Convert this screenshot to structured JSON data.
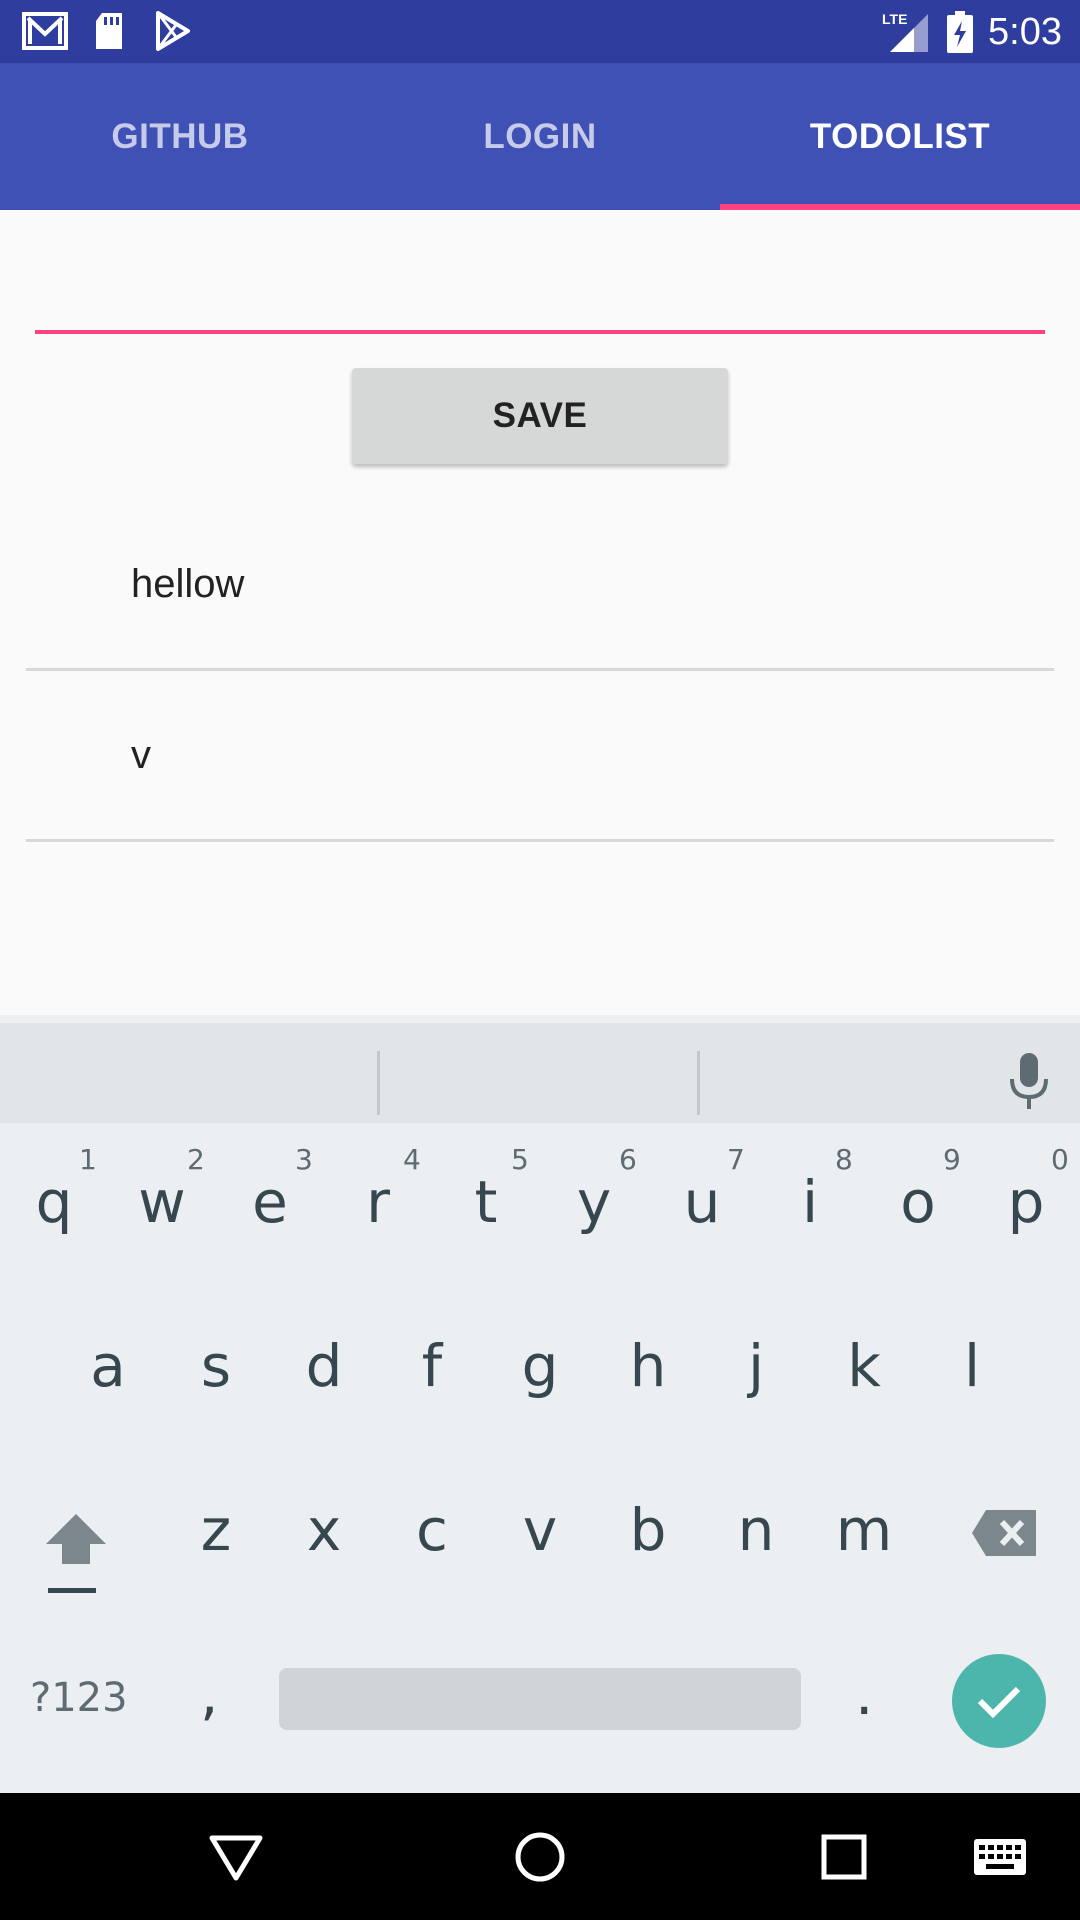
{
  "status_bar": {
    "time": "5:03",
    "network": "LTE",
    "left_icons": [
      "gmail-icon",
      "sd-card-icon",
      "play-store-icon"
    ],
    "right_icons": [
      "lte-signal-icon",
      "battery-charging-icon"
    ]
  },
  "tabs": [
    {
      "label": "GITHUB",
      "active": false
    },
    {
      "label": "LOGIN",
      "active": false
    },
    {
      "label": "TODOLIST",
      "active": true
    }
  ],
  "todo": {
    "input_value": "",
    "input_placeholder": "",
    "save_label": "SAVE",
    "items": [
      "hellow",
      "v"
    ]
  },
  "keyboard": {
    "row1": [
      "q",
      "w",
      "e",
      "r",
      "t",
      "y",
      "u",
      "i",
      "o",
      "p"
    ],
    "row1_numbers": [
      "1",
      "2",
      "3",
      "4",
      "5",
      "6",
      "7",
      "8",
      "9",
      "0"
    ],
    "row2": [
      "a",
      "s",
      "d",
      "f",
      "g",
      "h",
      "j",
      "k",
      "l"
    ],
    "row3": [
      "z",
      "x",
      "c",
      "v",
      "b",
      "n",
      "m"
    ],
    "symbols_label": "?123",
    "comma": ",",
    "period": "."
  },
  "colors": {
    "status_bar": "#2f3d9e",
    "app_bar": "#3f51b5",
    "accent": "#ff4081",
    "enter": "#4db6ac"
  }
}
